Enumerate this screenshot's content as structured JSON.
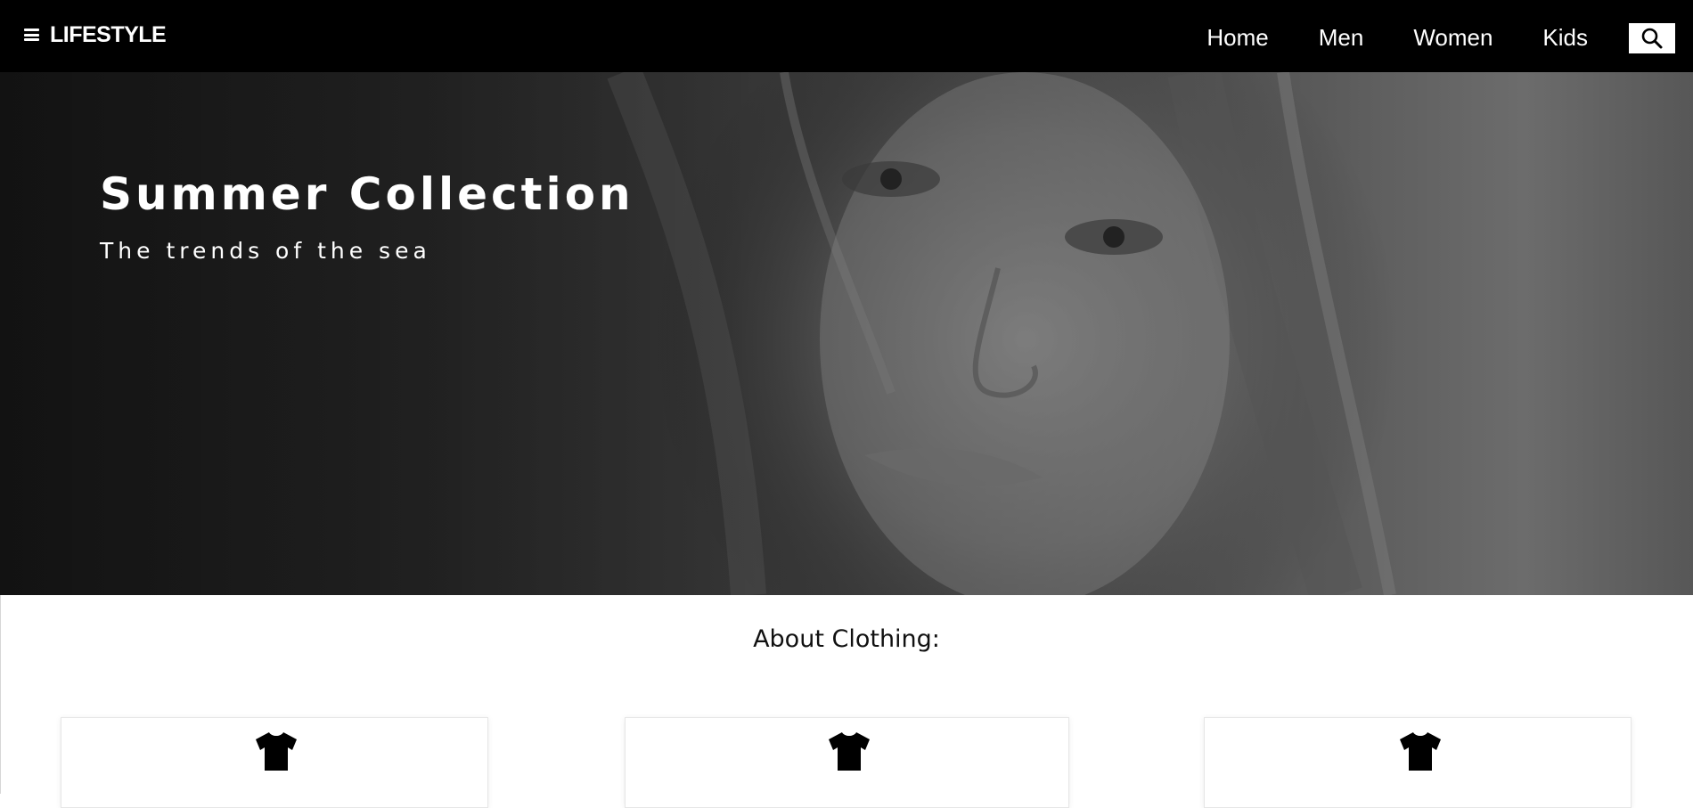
{
  "header": {
    "brand": "LIFESTYLE",
    "menu_icon": "hamburger-menu-icon",
    "nav": [
      {
        "label": "Home"
      },
      {
        "label": "Men"
      },
      {
        "label": "Women"
      },
      {
        "label": "Kids"
      }
    ],
    "search_icon": "search-icon"
  },
  "hero": {
    "title": "Summer Collection",
    "subtitle": "The trends of the sea"
  },
  "about": {
    "heading": "About Clothing:",
    "cards": [
      {
        "icon": "tshirt-icon"
      },
      {
        "icon": "tshirt-icon"
      },
      {
        "icon": "tshirt-icon"
      }
    ]
  },
  "colors": {
    "navbar": "#000000",
    "text_on_dark": "#ffffff",
    "page": "#ffffff"
  }
}
